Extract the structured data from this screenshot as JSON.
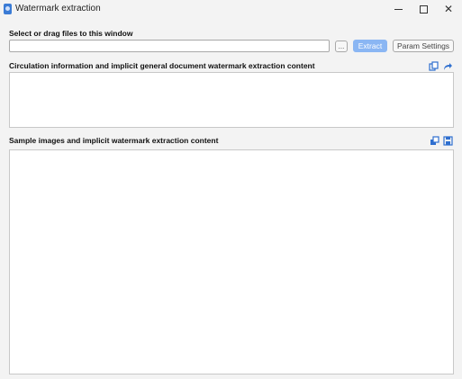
{
  "window": {
    "title": "Watermark extraction",
    "icons": {
      "app": "app-icon",
      "minimize": "minimize-icon",
      "maximize": "maximize-icon",
      "close": "close-icon"
    }
  },
  "file_section": {
    "label": "Select or drag files to this window",
    "path_value": "",
    "browse_label": "...",
    "extract_label": "Extract",
    "param_label": "Param Settings"
  },
  "circulation_section": {
    "label": "Circulation information and implicit general document watermark extraction content",
    "content": "",
    "icons": [
      "copy-icon",
      "share-icon"
    ]
  },
  "sample_section": {
    "label": "Sample images and implicit watermark extraction content",
    "content": "",
    "icons": [
      "restore-icon",
      "save-icon"
    ]
  },
  "colors": {
    "accent": "#3a7bd5",
    "extract_button": "#8ab6f3",
    "background": "#f3f3f3"
  }
}
